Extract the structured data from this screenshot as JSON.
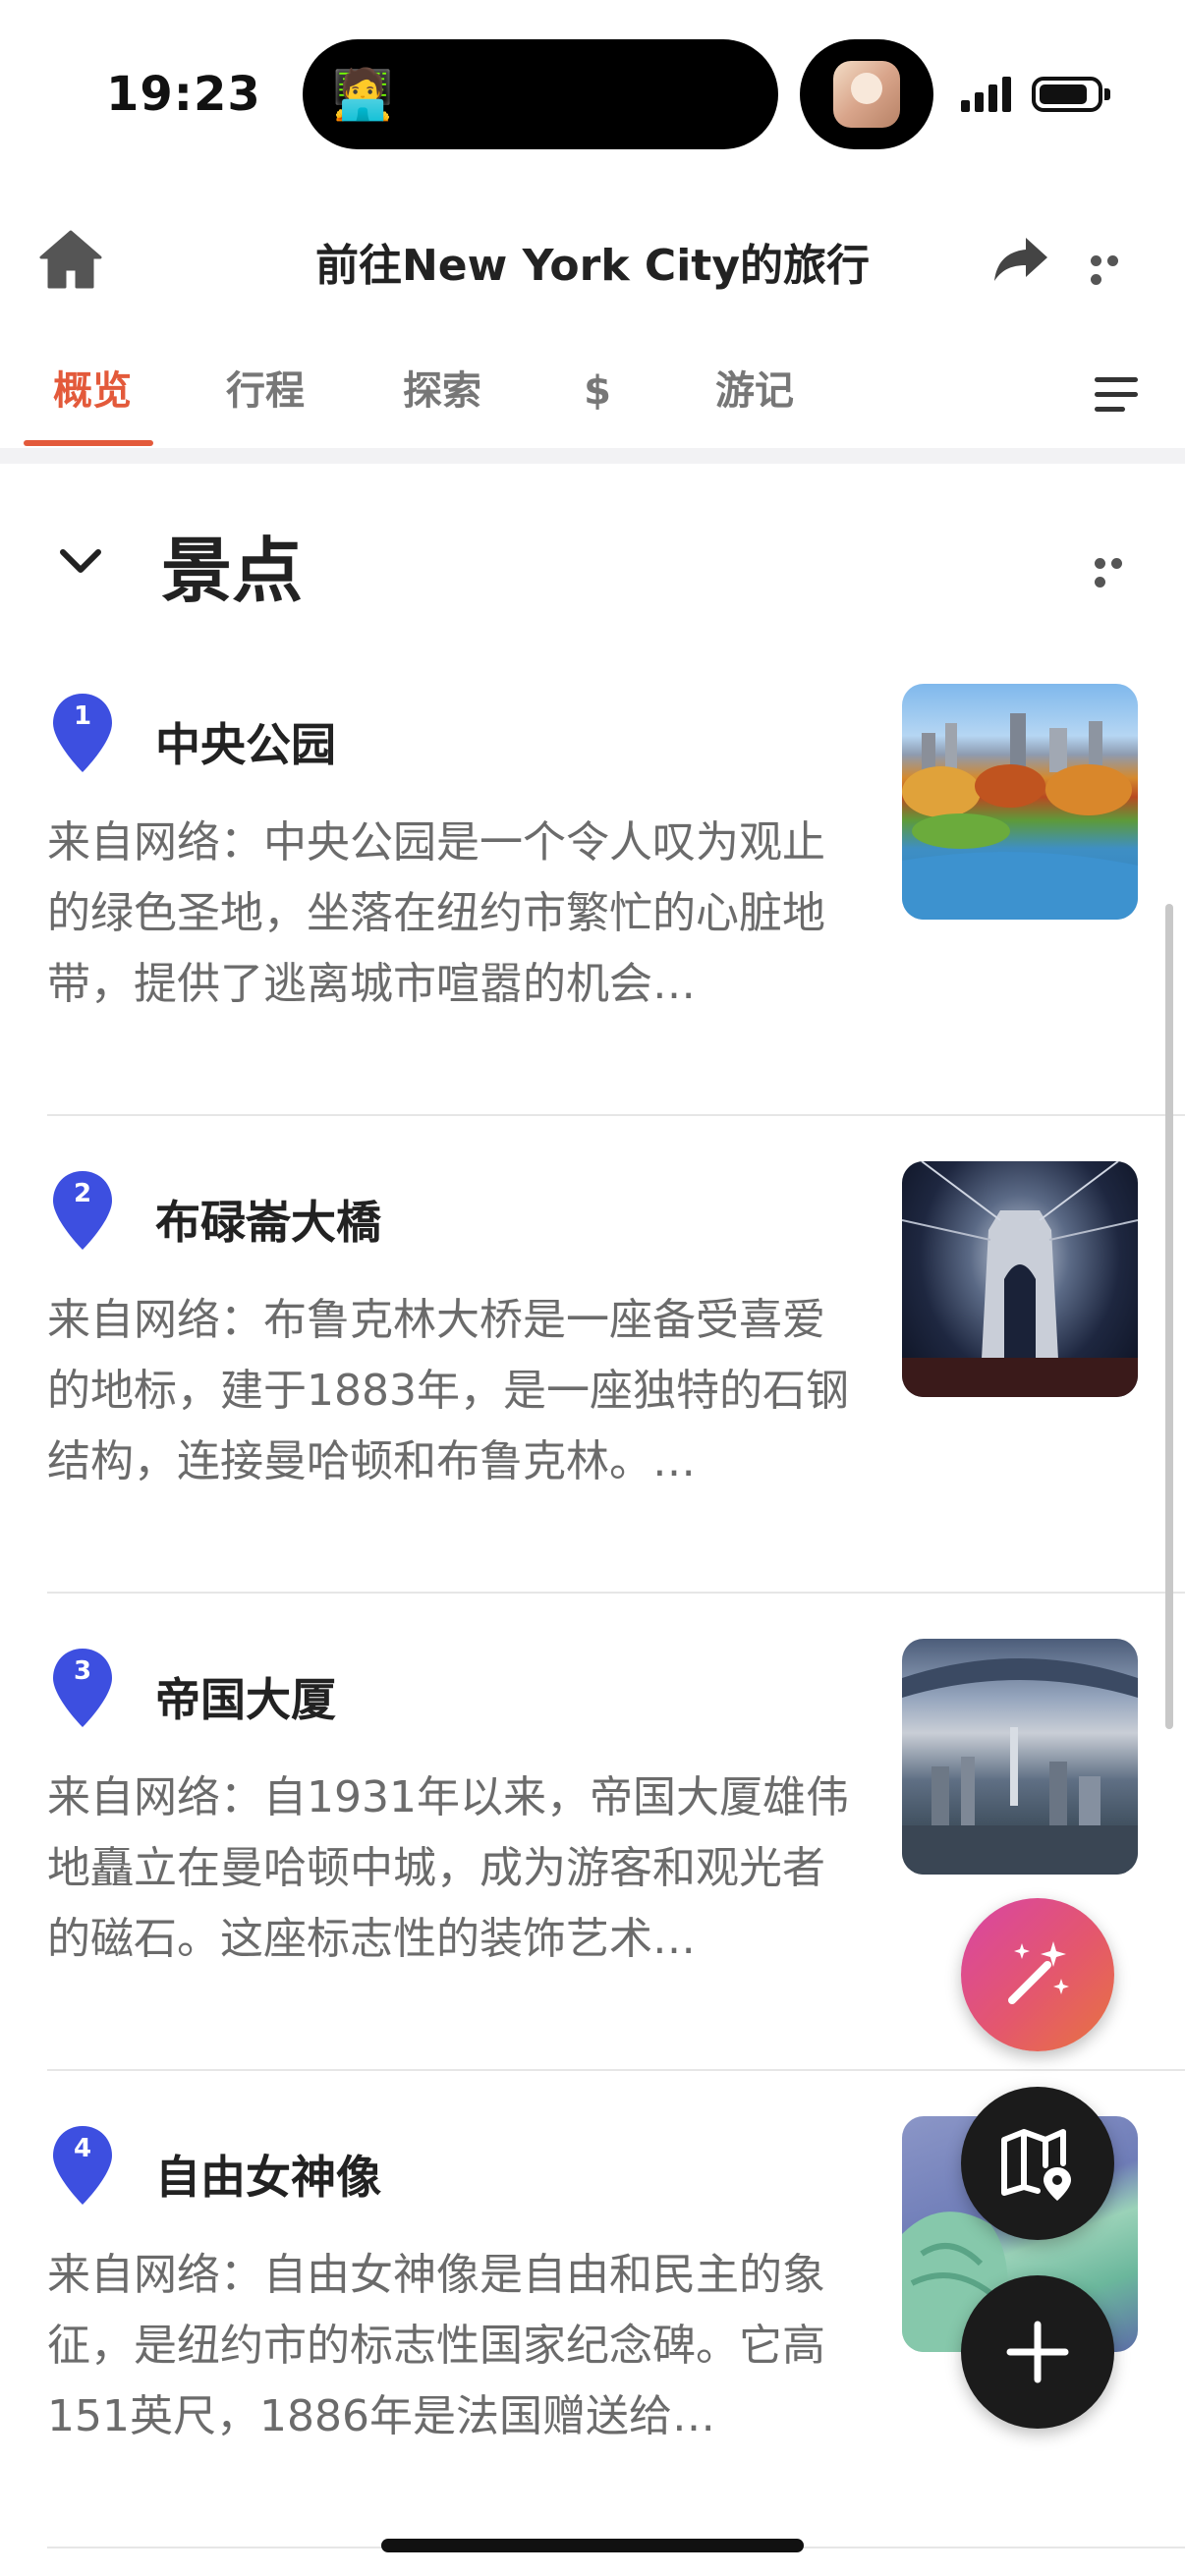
{
  "status_bar": {
    "time": "19:23",
    "island_emoji": "🧑‍💻"
  },
  "header": {
    "title": "前往New York City的旅行"
  },
  "tabs": [
    {
      "label": "概览",
      "active": true
    },
    {
      "label": "行程",
      "active": false
    },
    {
      "label": "探索",
      "active": false
    },
    {
      "label": "$",
      "active": false
    },
    {
      "label": "游记",
      "active": false
    }
  ],
  "section": {
    "title": "景点"
  },
  "places": [
    {
      "number": "1",
      "name": "中央公园",
      "description": "来自网络：中央公园是一个令人叹为观止的绿色圣地，坐落在纽约市繁忙的心脏地带，提供了逃离城市喧嚣的机会…"
    },
    {
      "number": "2",
      "name": "布碌崙大橋",
      "description": "来自网络：布鲁克林大桥是一座备受喜爱的地标，建于1883年，是一座独特的石钢结构，连接曼哈顿和布鲁克林。…"
    },
    {
      "number": "3",
      "name": "帝国大厦",
      "description": "来自网络：自1931年以来，帝国大厦雄伟地矗立在曼哈顿中城，成为游客和观光者的磁石。这座标志性的装饰艺术…"
    },
    {
      "number": "4",
      "name": "自由女神像",
      "description": "来自网络：自由女神像是自由和民主的象征，是纽约市的标志性国家纪念碑。它高151英尺，1886年是法国赠送给…"
    }
  ],
  "colors": {
    "accent": "#e35a3b",
    "pin": "#3d4fe0"
  },
  "icons": {
    "home": "home-icon",
    "share": "share-icon",
    "more": "more-icon",
    "menu": "menu-icon",
    "collapse": "chevron-down-icon",
    "magic": "magic-wand-icon",
    "map": "map-pin-icon",
    "add": "plus-icon"
  }
}
